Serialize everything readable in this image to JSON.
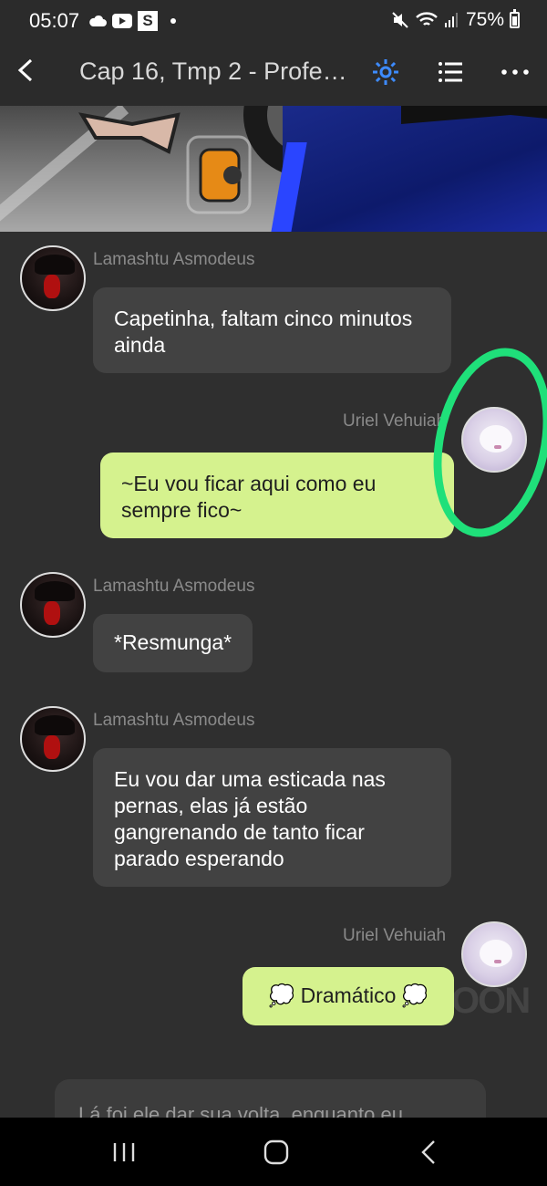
{
  "status_bar": {
    "time": "05:07",
    "battery": "75%",
    "icons": [
      "cloud-icon",
      "youtube-icon",
      "s-app-icon",
      "dot-icon",
      "mute-icon",
      "wifi-icon",
      "signal-icon",
      "battery-icon"
    ],
    "s_app_letter": "S"
  },
  "top_bar": {
    "title": "Cap 16, Tmp 2 - Profe…",
    "accent_color": "#3d8bff"
  },
  "messages": [
    {
      "sender": "Lamashtu Asmodeus",
      "text": "Capetinha, faltam cinco minutos ainda",
      "direction": "in"
    },
    {
      "sender": "Uriel Vehuiah",
      "text": "~Eu vou ficar aqui como eu sempre fico~",
      "direction": "out"
    },
    {
      "sender": "Lamashtu Asmodeus",
      "text": "*Resmunga*",
      "direction": "in"
    },
    {
      "sender": "Lamashtu Asmodeus",
      "text": "Eu vou dar uma esticada nas pernas, elas já estão gangrenando de tanto ficar parado esperando",
      "direction": "in"
    },
    {
      "sender": "Uriel Vehuiah",
      "text": "💭 Dramático 💭",
      "direction": "out"
    }
  ],
  "narration": {
    "text": "Lá foi ele dar sua volta, enquanto eu"
  },
  "watermark": "OON",
  "colors": {
    "bubble_out": "#d5f28e",
    "bubble_in": "#424242",
    "background": "#2f2f2f",
    "annotation": "#1fe07a"
  }
}
